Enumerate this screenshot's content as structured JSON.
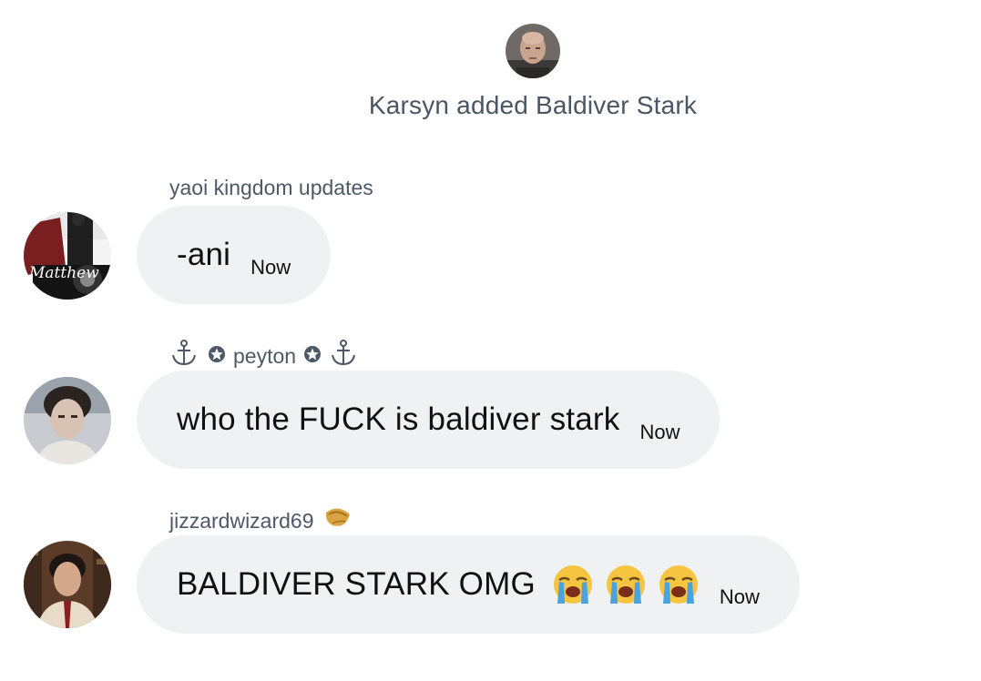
{
  "system_event": {
    "text": "Karsyn added Baldiver Stark",
    "avatar_icon": "bald-man-avatar"
  },
  "messages": [
    {
      "sender": "yaoi kingdom updates",
      "text": "-ani",
      "time": "Now",
      "avatar_text": "Matthew"
    },
    {
      "sender_name": "peyton",
      "sender_icons": [
        "anchor-icon",
        "star-badge-icon"
      ],
      "text": "who the FUCK is baldiver stark",
      "time": "Now"
    },
    {
      "sender": "jizzardwizard69",
      "sender_icon": "fortune-cookie-icon",
      "text": "BALDIVER STARK OMG",
      "emojis": [
        "loudly-crying-face-icon",
        "loudly-crying-face-icon",
        "loudly-crying-face-icon"
      ],
      "time": "Now"
    }
  ],
  "colors": {
    "bubble": "#eff1f3",
    "meta_text": "#4d5966",
    "body_text": "#111111"
  }
}
